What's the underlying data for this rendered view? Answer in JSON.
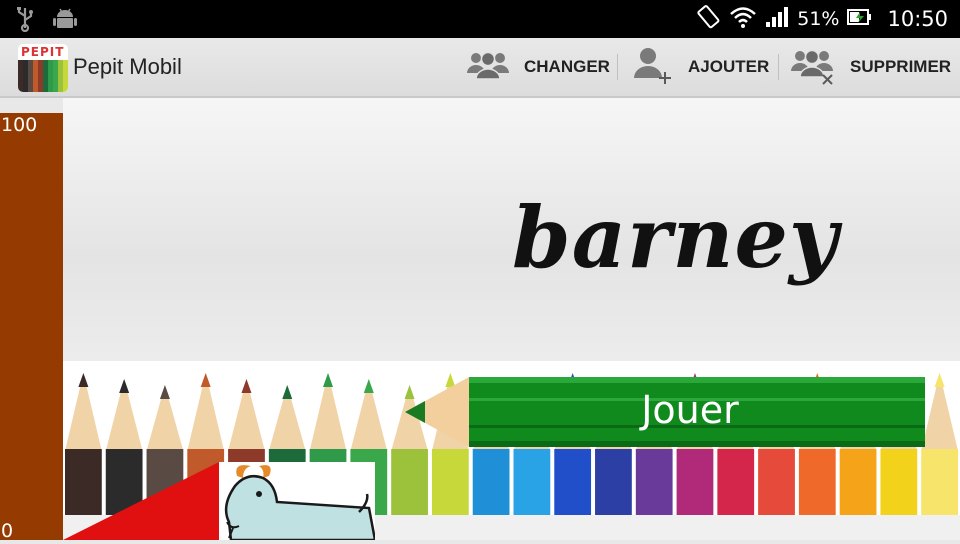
{
  "status_bar": {
    "battery": "51%",
    "time": "10:50"
  },
  "app": {
    "title": "Pepit Mobil",
    "logo_text": "PEPIT"
  },
  "actions": [
    {
      "label": "CHANGER"
    },
    {
      "label": "AJOUTER"
    },
    {
      "label": "SUPPRIMER"
    }
  ],
  "gauge": {
    "max_label": "100",
    "min_label": "0",
    "color": "#953a00"
  },
  "player": {
    "name": "barney"
  },
  "play_button": {
    "label": "Jouer",
    "color": "#118a1d"
  },
  "pencil_colors": [
    "#3b2a25",
    "#2b2b2b",
    "#5a4a44",
    "#c05a2a",
    "#8e3a2a",
    "#1d6b3a",
    "#2f9a4a",
    "#3aa84a",
    "#9bc23a",
    "#c6d83a",
    "#1f8fd8",
    "#2aa3e6",
    "#214fc9",
    "#2c3fa5",
    "#6a3a9a",
    "#b12a7a",
    "#d3264a",
    "#e64a3a",
    "#ef6a2a",
    "#f5a41a",
    "#f2d21a",
    "#f7e46a"
  ]
}
